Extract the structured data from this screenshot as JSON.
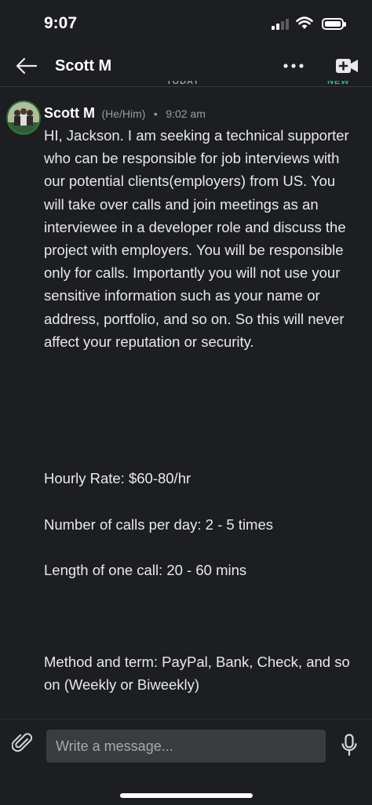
{
  "status_bar": {
    "time": "9:07",
    "icons": [
      "cellular-signal-icon",
      "wifi-icon",
      "battery-icon"
    ]
  },
  "header": {
    "title": "Scott M",
    "icons": [
      "back-arrow-icon",
      "more-options-icon",
      "video-call-icon"
    ]
  },
  "dividers": {
    "today": "TODAY",
    "new": "NEW"
  },
  "message": {
    "sender": "Scott M",
    "pronouns": "(He/Him)",
    "separator": "•",
    "time": "9:02 am",
    "paragraphs": [
      "HI, Jackson. I am seeking a technical supporter who can be responsible for job interviews with our potential clients(employers) from US. You will take over calls and join meetings as an interviewee in a developer role and discuss the project with employers. You will be responsible only for calls. Importantly you will not use your sensitive information such as your name or address, portfolio, and so on. So this will never affect your reputation or security.",
      "Hourly Rate: $60-80/hr",
      "Number of calls per day: 2 - 5 times",
      "Length of one call: 20 - 60 mins",
      "Method and term: PayPal, Bank, Check, and so on (Weekly or Biweekly)"
    ]
  },
  "composer": {
    "placeholder": "Write a message...",
    "value": "",
    "icons": [
      "paperclip-icon",
      "microphone-icon"
    ]
  },
  "colors": {
    "background": "#1c1e21",
    "text": "#e9e9ea",
    "muted": "#9a9c9f",
    "new_accent": "#2fbd73",
    "input_bg": "#3a3c40"
  }
}
